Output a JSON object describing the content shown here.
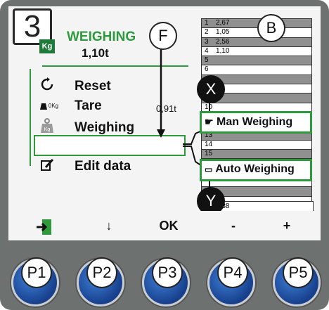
{
  "screen": {
    "step_number": "3",
    "title": "WEIGHING",
    "total_weight": "1,10t",
    "kg_badge": "Kg"
  },
  "menu": {
    "items": [
      {
        "label": "Reset",
        "icon": "refresh-icon"
      },
      {
        "label": "Tare",
        "icon": "tare-0kg-icon",
        "value": "0,91t"
      },
      {
        "label": "Weighing",
        "icon": "weight-kg-icon"
      },
      {
        "label": "",
        "icon": ""
      },
      {
        "label": "Edit data",
        "icon": "edit-icon"
      }
    ],
    "tare_icon_text": "0Kg"
  },
  "data_list": {
    "rows": [
      {
        "n": "1",
        "v": "2,67",
        "shade": "dark"
      },
      {
        "n": "2",
        "v": "1,05",
        "shade": "light"
      },
      {
        "n": "3",
        "v": "2,56",
        "shade": "dark"
      },
      {
        "n": "4",
        "v": "1,10",
        "shade": "light"
      },
      {
        "n": "5",
        "v": "",
        "shade": "dark"
      },
      {
        "n": "6",
        "v": "",
        "shade": "light"
      },
      {
        "n": "",
        "v": "",
        "shade": "dark"
      },
      {
        "n": "",
        "v": "",
        "shade": "light"
      },
      {
        "n": "",
        "v": "",
        "shade": "dark"
      },
      {
        "n": "10",
        "v": "",
        "shade": "light"
      },
      {
        "n": "",
        "v": "",
        "shade": "dark"
      },
      {
        "n": "",
        "v": "",
        "shade": "light"
      },
      {
        "n": "13",
        "v": "",
        "shade": "dark"
      },
      {
        "n": "14",
        "v": "",
        "shade": "light"
      },
      {
        "n": "15",
        "v": "",
        "shade": "dark"
      },
      {
        "n": "",
        "v": "",
        "shade": "light"
      },
      {
        "n": "",
        "v": "",
        "shade": "dark"
      },
      {
        "n": "",
        "v": "",
        "shade": "light"
      },
      {
        "n": "",
        "v": "",
        "shade": "dark"
      },
      {
        "n": "",
        "v": "",
        "shade": "light"
      }
    ],
    "last_value": "7,38"
  },
  "popups": {
    "man_weighing": "Man Weighing",
    "auto_weighing": "Auto Weighing"
  },
  "callouts": {
    "f": "F",
    "b": "B",
    "x": "X",
    "y": "Y"
  },
  "softkeys": {
    "p1_icon": "exit-door-icon",
    "p2": "↓",
    "p3": "OK",
    "p4": "-",
    "p5": "+"
  },
  "hardware_buttons": [
    "P1",
    "P2",
    "P3",
    "P4",
    "P5"
  ],
  "colors": {
    "accent_green": "#2f9a3c",
    "button_blue": "#2a5fb8",
    "bezel": "#6d7270"
  }
}
